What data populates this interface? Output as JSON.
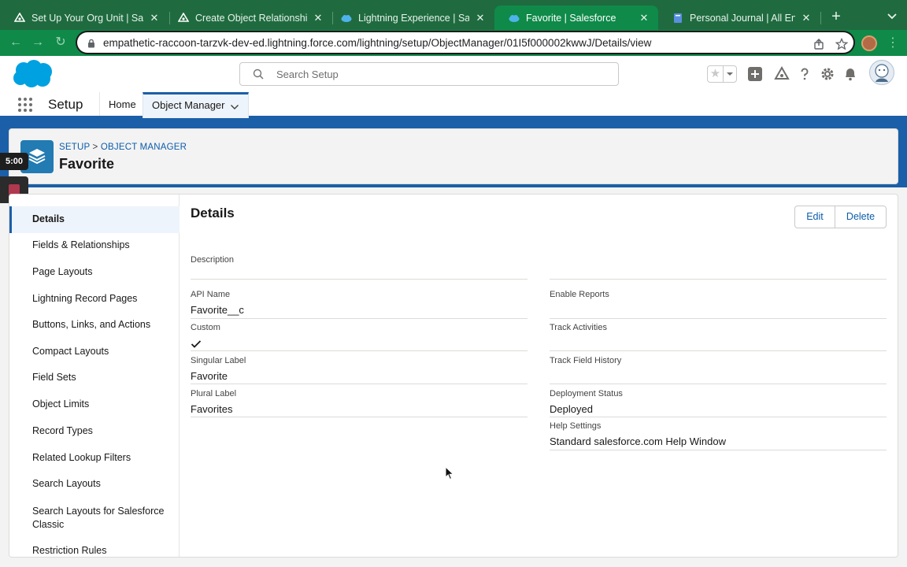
{
  "browser": {
    "tabs": [
      {
        "title": "Set Up Your Org Unit | Salesf",
        "favicon": "trailhead-icon",
        "active": false
      },
      {
        "title": "Create Object Relationships U",
        "favicon": "trailhead-icon",
        "active": false
      },
      {
        "title": "Lightning Experience | Salesf",
        "favicon": "salesforce-cloud-icon",
        "active": false
      },
      {
        "title": "Favorite | Salesforce",
        "favicon": "salesforce-cloud-icon",
        "active": true
      },
      {
        "title": "Personal Journal | All Entries",
        "favicon": "journal-icon",
        "active": false
      }
    ],
    "new_tab": "+",
    "url": "empathetic-raccoon-tarzvk-dev-ed.lightning.force.com/lightning/setup/ObjectManager/01I5f000002kwwJ/Details/view",
    "accent_color": "#0f8a49"
  },
  "header": {
    "search_placeholder": "Search Setup"
  },
  "context_bar": {
    "app_name": "Setup",
    "home_label": "Home",
    "object_manager_label": "Object Manager"
  },
  "recorder": {
    "timer": "5:00"
  },
  "object": {
    "breadcrumb_setup": "SETUP",
    "breadcrumb_sep": ">",
    "breadcrumb_object_manager": "OBJECT MANAGER",
    "title": "Favorite"
  },
  "sidebar": {
    "items": [
      {
        "label": "Details",
        "active": true
      },
      {
        "label": "Fields & Relationships"
      },
      {
        "label": "Page Layouts"
      },
      {
        "label": "Lightning Record Pages"
      },
      {
        "label": "Buttons, Links, and Actions"
      },
      {
        "label": "Compact Layouts"
      },
      {
        "label": "Field Sets"
      },
      {
        "label": "Object Limits"
      },
      {
        "label": "Record Types"
      },
      {
        "label": "Related Lookup Filters"
      },
      {
        "label": "Search Layouts"
      },
      {
        "label": "Search Layouts for Salesforce Classic"
      },
      {
        "label": "Restriction Rules"
      }
    ]
  },
  "details": {
    "title": "Details",
    "edit_label": "Edit",
    "delete_label": "Delete",
    "left_fields": [
      {
        "label": "Description",
        "value": ""
      },
      {
        "label": "API Name",
        "value": "Favorite__c"
      },
      {
        "label": "Custom",
        "value": "",
        "checked": true
      },
      {
        "label": "Singular Label",
        "value": "Favorite"
      },
      {
        "label": "Plural Label",
        "value": "Favorites"
      }
    ],
    "right_fields": [
      {
        "label": "Enable Reports",
        "value": ""
      },
      {
        "label": "Track Activities",
        "value": ""
      },
      {
        "label": "Track Field History",
        "value": ""
      },
      {
        "label": "Deployment Status",
        "value": "Deployed"
      },
      {
        "label": "Help Settings",
        "value": "Standard salesforce.com Help Window"
      }
    ]
  }
}
